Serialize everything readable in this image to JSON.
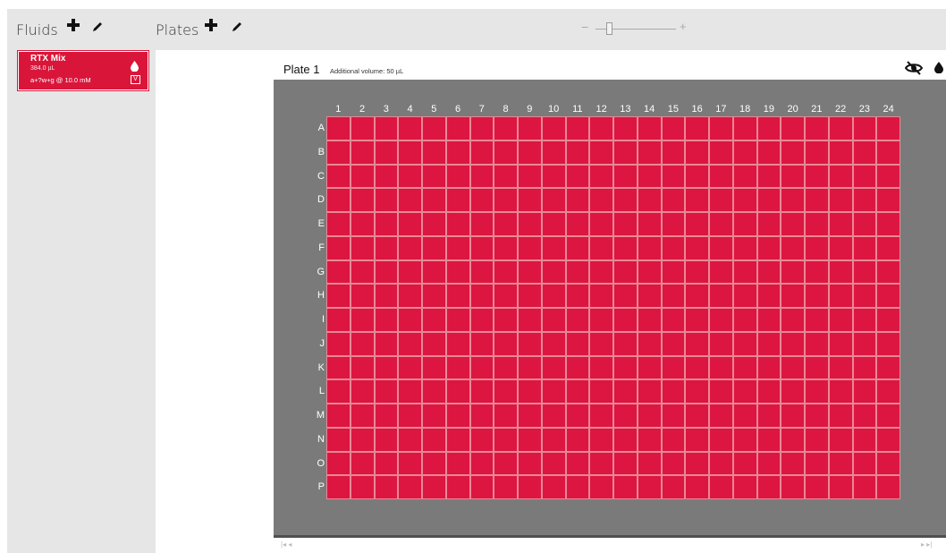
{
  "fluids": {
    "title": "Fluids",
    "add_icon": "plus-icon",
    "edit_icon": "pencil-icon",
    "items": [
      {
        "name": "RTX Mix",
        "volume": "384.0 µL",
        "formula": "a+?w+g @ 10.0 mM",
        "drop_icon": "drop-icon",
        "badge": "V",
        "color": "#d9163a"
      }
    ]
  },
  "plates": {
    "title": "Plates",
    "add_icon": "plus-icon",
    "edit_icon": "pencil-icon"
  },
  "zoom": {
    "minus_label": "−",
    "plus_label": "+",
    "level": 0.13
  },
  "plate": {
    "title": "Plate 1",
    "additional_volume": "Additional volume: 50 µL",
    "columns": [
      "1",
      "2",
      "3",
      "4",
      "5",
      "6",
      "7",
      "8",
      "9",
      "10",
      "11",
      "12",
      "13",
      "14",
      "15",
      "16",
      "17",
      "18",
      "19",
      "20",
      "21",
      "22",
      "23",
      "24"
    ],
    "rows": [
      "A",
      "B",
      "C",
      "D",
      "E",
      "F",
      "G",
      "H",
      "I",
      "J",
      "K",
      "L",
      "M",
      "N",
      "O",
      "P"
    ],
    "well_color": "#dc1640",
    "frame_color": "#7a7a7a"
  },
  "scroll": {
    "left_label": "|◂  ◂",
    "right_label": "▸  ▸|"
  }
}
